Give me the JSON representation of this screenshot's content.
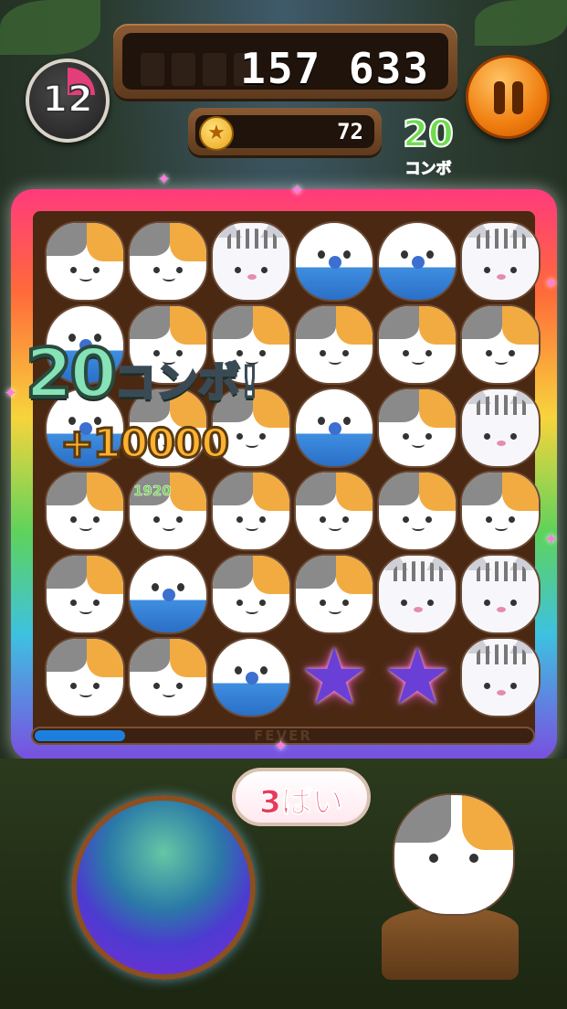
{
  "hud": {
    "score": "157 633",
    "coins": "72",
    "moves_left": "12",
    "combo_count": "20",
    "combo_label": "コンボ"
  },
  "combo_popup": {
    "number": "20",
    "text": "コンボ!",
    "bonus": "+10000"
  },
  "tile_points": "1920",
  "fever": {
    "label": "FEVER",
    "progress": 0.18
  },
  "multiplier": "3ばい",
  "colors": {
    "fever_fill": "#1c7fe0",
    "combo_green": "#6fdc4e",
    "pause_orange": "#f07e10"
  },
  "board": [
    [
      "cat",
      "cat",
      "tiger",
      "bird",
      "bird",
      "tiger"
    ],
    [
      "bird",
      "cat",
      "cat",
      "cat",
      "cat",
      "cat"
    ],
    [
      "bird",
      "cat",
      "cat",
      "bird",
      "cat",
      "tiger"
    ],
    [
      "cat",
      "cat",
      "cat",
      "cat",
      "cat",
      "cat"
    ],
    [
      "cat",
      "bird",
      "cat",
      "cat",
      "tiger",
      "tiger"
    ],
    [
      "cat",
      "cat",
      "bird",
      "star",
      "star",
      "tiger"
    ]
  ],
  "icons": {
    "coin": "coin-icon",
    "pause": "pause-icon",
    "star_tile": "star-icon"
  }
}
